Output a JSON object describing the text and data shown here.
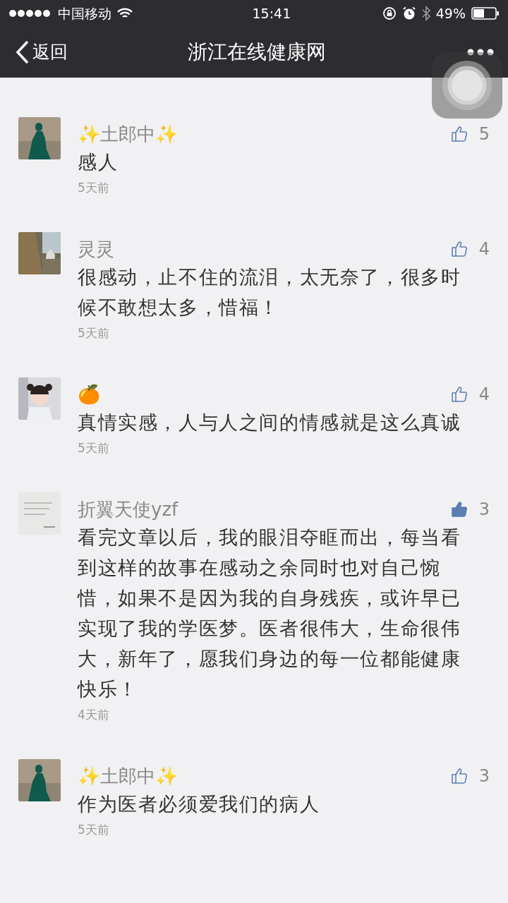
{
  "status_bar": {
    "carrier": "中国移动",
    "time": "15:41",
    "battery": "49%"
  },
  "nav": {
    "back": "返回",
    "title": "浙江在线健康网"
  },
  "comments": [
    {
      "name": "✨土郎中✨",
      "text": "感人",
      "time": "5天前",
      "likes": "5",
      "liked": false
    },
    {
      "name": "灵灵",
      "text": "很感动，止不住的流泪，太无奈了，很多时候不敢想太多，惜福！",
      "time": "5天前",
      "likes": "4",
      "liked": false
    },
    {
      "name": "🍊",
      "text": "真情实感，人与人之间的情感就是这么真诚",
      "time": "5天前",
      "likes": "4",
      "liked": false
    },
    {
      "name": "折翼天使yzf",
      "text": "看完文章以后，我的眼泪夺眶而出，每当看到这样的故事在感动之余同时也对自己惋惜，如果不是因为我的自身残疾，或许早已实现了我的学医梦。医者很伟大，生命很伟大，新年了，愿我们身边的每一位都能健康快乐！",
      "time": "4天前",
      "likes": "3",
      "liked": true
    },
    {
      "name": "✨土郎中✨",
      "text": "作为医者必须爱我们的病人",
      "time": "5天前",
      "likes": "3",
      "liked": false
    }
  ]
}
